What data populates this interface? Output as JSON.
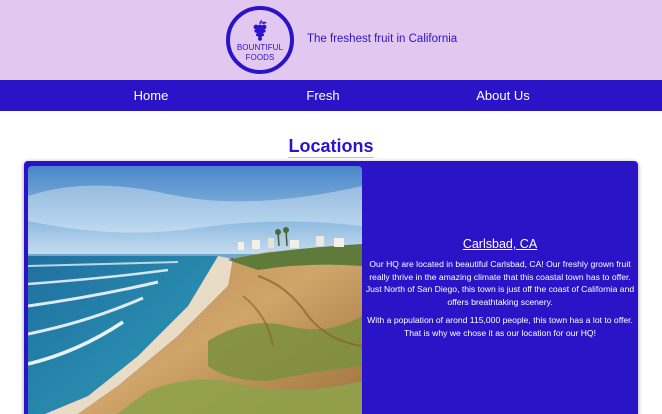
{
  "header": {
    "logo": {
      "line1": "BOUNTIFUL",
      "line2": "FOODS",
      "icon": "grapes-icon"
    },
    "tagline": "The freshest fruit in California"
  },
  "nav": {
    "items": [
      {
        "label": "Home"
      },
      {
        "label": "Fresh"
      },
      {
        "label": "About Us"
      }
    ]
  },
  "main": {
    "title": "Locations",
    "location": {
      "name": "Carlsbad, CA",
      "paragraphs": [
        "Our HQ are located in beautiful Carlsbad, CA! Our freshly grown fruit really thrive in the amazing climate that this coastal town has to offer. Just North of San Diego, this town is just off the coast of California and offers breathtaking scenery.",
        "With a population of arond 115,000 people, this town has a lot to offer. That is why we chose it as our location for our HQ!"
      ],
      "photo": "coastal-cliffs-photo"
    }
  },
  "colors": {
    "brand": "#2b14c8",
    "header_bg": "#e2c8f0",
    "nav_text": "#ffffff"
  }
}
